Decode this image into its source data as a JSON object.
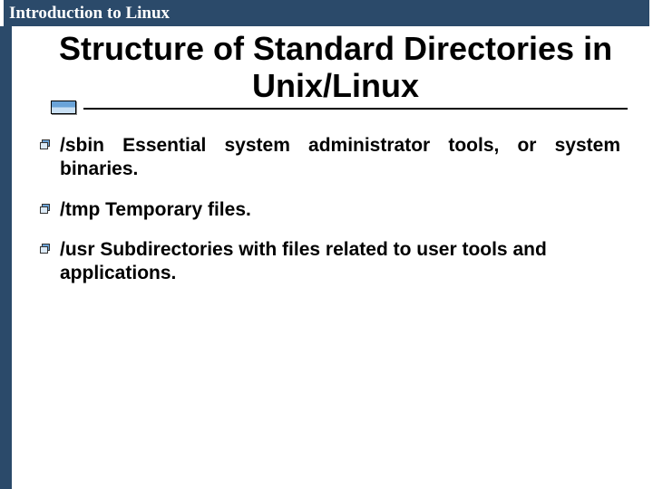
{
  "header": {
    "course_title": "Introduction to Linux"
  },
  "slide": {
    "title": "Structure of Standard Directories in Unix/Linux"
  },
  "bullets": [
    {
      "text": "/sbin Essential system administrator tools, or system binaries.",
      "justify": true
    },
    {
      "text": "/tmp Temporary files.",
      "justify": false
    },
    {
      "text": "/usr Subdirectories with files related to user tools and applications.",
      "justify": false
    }
  ]
}
